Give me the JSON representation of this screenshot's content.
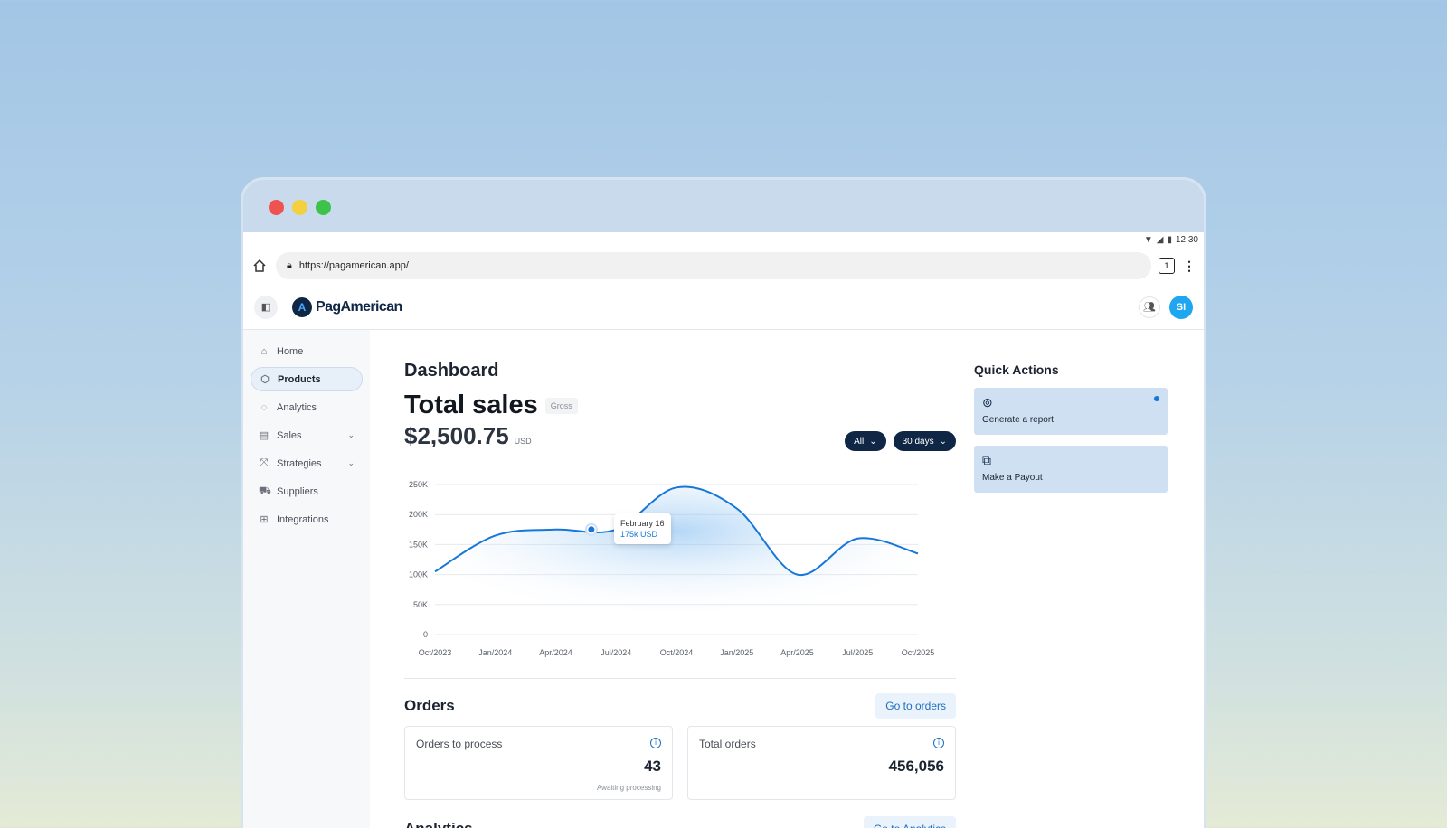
{
  "browser": {
    "status_time": "12:30",
    "url": "https://pagamerican.app/",
    "tab_count": "1"
  },
  "app": {
    "brand": "PagAmerican",
    "avatar_initials": "SI"
  },
  "sidebar": {
    "items": [
      {
        "label": "Home",
        "icon": "home-icon"
      },
      {
        "label": "Products",
        "icon": "box-icon"
      },
      {
        "label": "Analytics",
        "icon": "analytics-icon"
      },
      {
        "label": "Sales",
        "icon": "store-icon"
      },
      {
        "label": "Strategies",
        "icon": "strategy-icon"
      },
      {
        "label": "Suppliers",
        "icon": "truck-icon"
      },
      {
        "label": "Integrations",
        "icon": "integrations-icon"
      }
    ]
  },
  "main": {
    "page_title": "Dashboard",
    "sales_title": "Total sales",
    "gross_badge": "Gross",
    "amount": "$2,500.75",
    "currency": "USD",
    "filter_all": "All",
    "filter_range": "30 days",
    "tooltip_date": "February 16",
    "tooltip_value": "175k USD",
    "orders_title": "Orders",
    "go_orders": "Go to orders",
    "orders_to_process_label": "Orders to process",
    "orders_to_process_value": "43",
    "orders_to_process_sub": "Awaiting processing",
    "total_orders_label": "Total orders",
    "total_orders_value": "456,056",
    "analytics_title": "Analytics",
    "go_analytics": "Go to Analytics"
  },
  "quick_actions": {
    "title": "Quick Actions",
    "items": [
      {
        "label": "Generate a report",
        "icon": "report-icon"
      },
      {
        "label": "Make a Payout",
        "icon": "payout-icon"
      }
    ]
  },
  "chart_data": {
    "type": "line",
    "x": [
      "Oct/2023",
      "Jan/2024",
      "Apr/2024",
      "Jul/2024",
      "Oct/2024",
      "Jan/2025",
      "Apr/2025",
      "Jul/2025",
      "Oct/2025"
    ],
    "x_tick_labels": [
      "Oct/2023",
      "Jan/2024",
      "Apr/2024",
      "Jul/2024",
      "Oct/2024",
      "Jan/2025",
      "Apr/2025",
      "Jul/2025",
      "Oct/2025"
    ],
    "y_tick_labels": [
      "0",
      "50K",
      "100K",
      "150K",
      "200K",
      "250K"
    ],
    "ylim": [
      0,
      250000
    ],
    "series": [
      {
        "values": [
          105000,
          165000,
          175000,
          175000,
          245000,
          210000,
          100000,
          160000,
          135000
        ]
      }
    ],
    "grid": true,
    "color": "#1677d9"
  }
}
